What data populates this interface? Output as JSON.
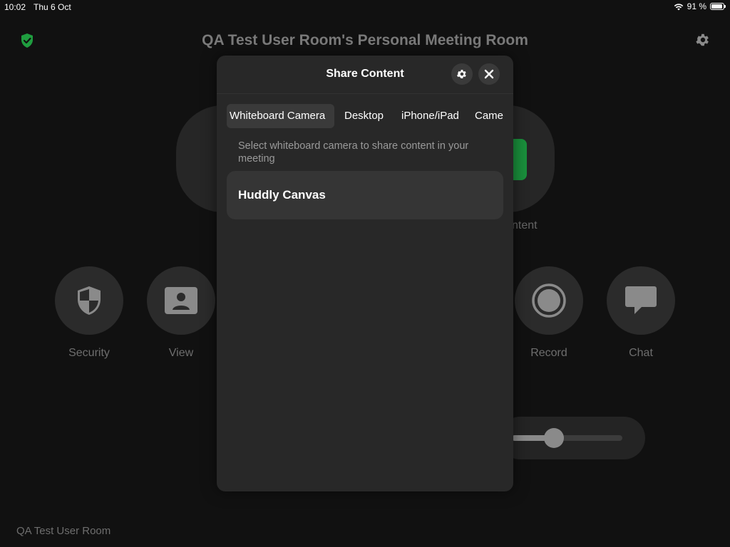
{
  "status_bar": {
    "time": "10:02",
    "date": "Thu 6 Oct",
    "battery": "91 %",
    "battery_level": 0.91
  },
  "header": {
    "room_title": "QA Test User Room's Personal Meeting Room"
  },
  "background": {
    "partial_label": "ntent",
    "controls": [
      {
        "label": "Security",
        "icon": "security-shield-icon"
      },
      {
        "label": "View",
        "icon": "person-view-icon"
      },
      {
        "label": "Record",
        "icon": "record-icon"
      },
      {
        "label": "Chat",
        "icon": "chat-bubble-icon"
      }
    ],
    "volume_level": 0.45,
    "footer_room_name": "QA Test User Room",
    "colors": {
      "background": "#111111",
      "accent_green": "#1a8f3c",
      "shield_green": "#1f9d3f"
    }
  },
  "modal": {
    "title": "Share Content",
    "tabs": [
      {
        "label": "Whiteboard Camera",
        "active": true
      },
      {
        "label": "Desktop",
        "active": false
      },
      {
        "label": "iPhone/iPad",
        "active": false
      },
      {
        "label": "Came",
        "active": false
      }
    ],
    "hint": "Select whiteboard camera to share content in your meeting",
    "devices": [
      {
        "label": "Huddly Canvas"
      }
    ],
    "icons": {
      "settings": "gear-icon",
      "close": "close-icon"
    }
  }
}
